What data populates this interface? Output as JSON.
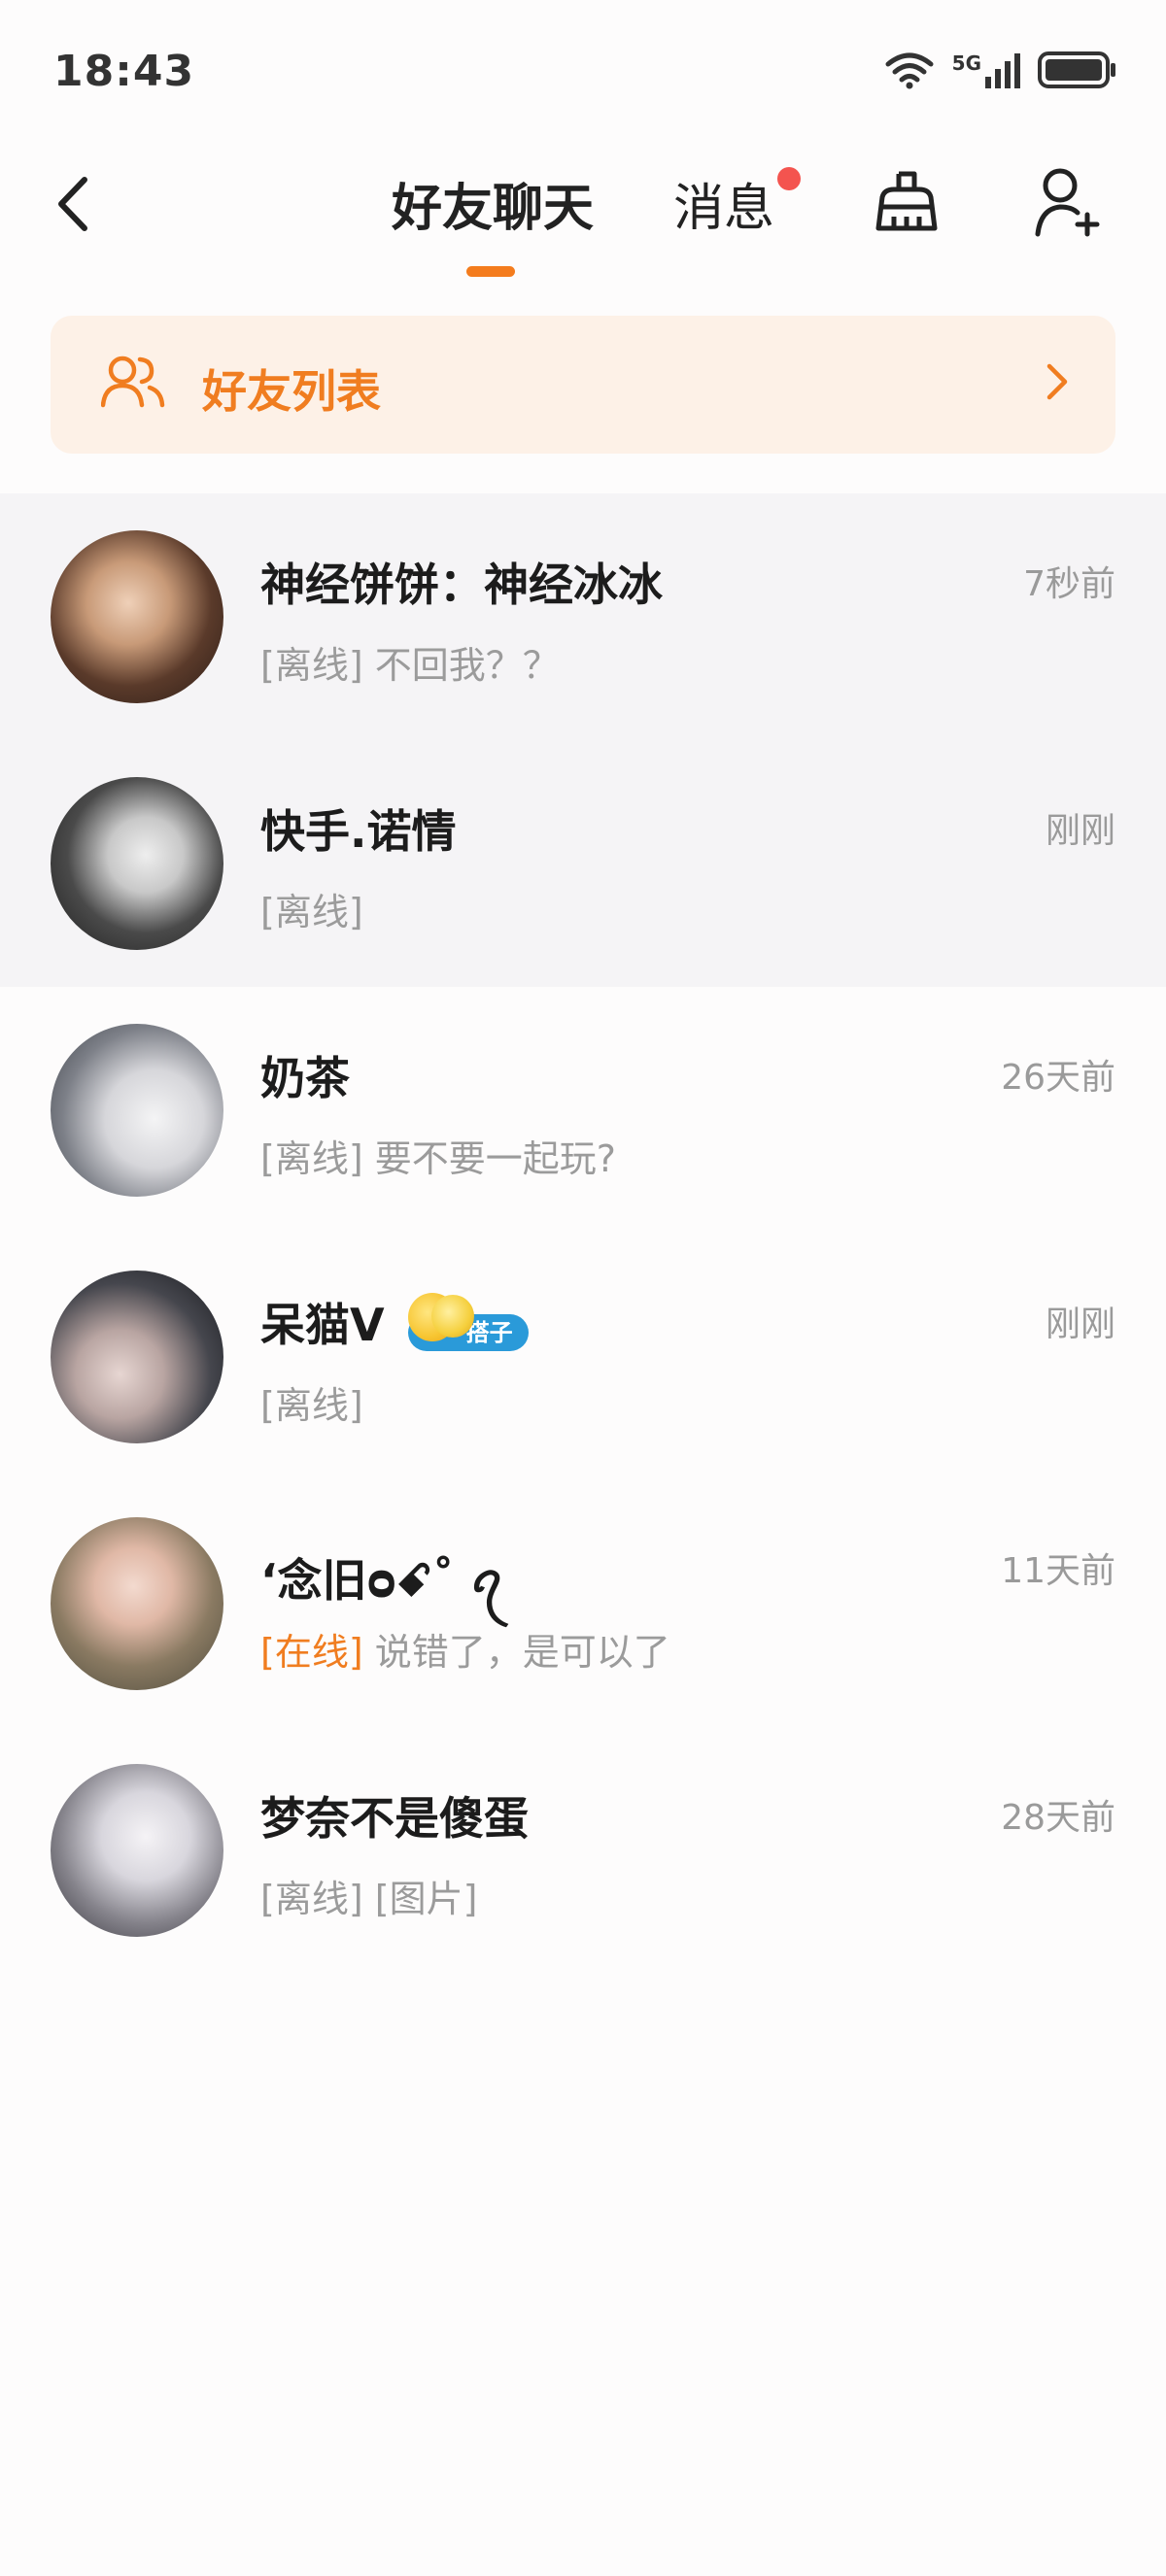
{
  "status_bar": {
    "time": "18:43",
    "network": "5G"
  },
  "header": {
    "tabs": [
      {
        "label": "好友聊天"
      },
      {
        "label": "消息"
      }
    ]
  },
  "friend_banner": {
    "label": "好友列表"
  },
  "chats": [
    {
      "name": "神经饼饼：神经冰冰",
      "time": "7秒前",
      "status": "[离线]",
      "message": "不回我？？",
      "pinned": true,
      "avatar_colors": [
        "#3a2a22",
        "#c89a78"
      ]
    },
    {
      "name": "快手.诺情",
      "time": "刚刚",
      "status": "[离线]",
      "message": "",
      "pinned": true,
      "avatar_colors": [
        "#2b2b2b",
        "#d8d8d8"
      ]
    },
    {
      "name": "奶茶",
      "time": "26天前",
      "status": "[离线]",
      "message": "要不要一起玩?",
      "pinned": false,
      "avatar_colors": [
        "#5a5f66",
        "#e6e6e8"
      ]
    },
    {
      "name": "呆猫V",
      "time": "刚刚",
      "status": "[离线]",
      "message": "",
      "pinned": false,
      "badge_label": "搭子",
      "avatar_colors": [
        "#24262b",
        "#c7b8b6"
      ]
    },
    {
      "name": "ʻ念旧ᴑꗃ˚ ꪖ",
      "time": "11天前",
      "status": "[在线]",
      "message": "说错了，是可以了",
      "pinned": false,
      "online": true,
      "avatar_colors": [
        "#6d6a57",
        "#e9c9bd"
      ]
    },
    {
      "name": "梦奈不是傻蛋",
      "time": "28天前",
      "status": "[离线]",
      "message": "[图片]",
      "pinned": false,
      "avatar_colors": [
        "#3d3d44",
        "#dcdbe0"
      ]
    }
  ],
  "colors": {
    "accent": "#f07d20",
    "badge_dot": "#f4544f",
    "tag_blue": "#2a9ad9"
  }
}
